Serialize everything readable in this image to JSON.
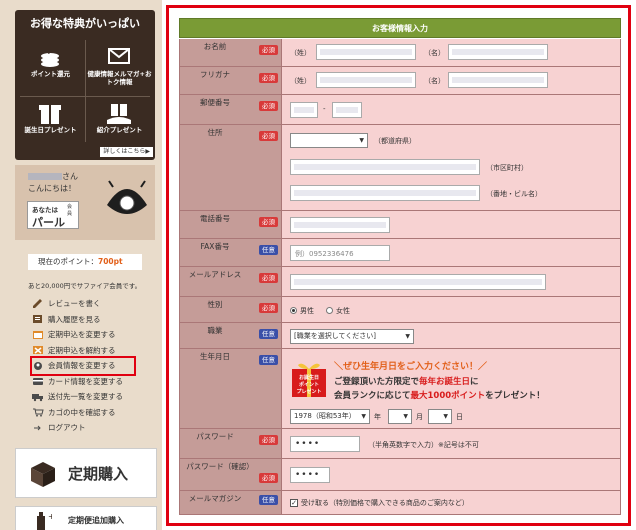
{
  "sidebar": {
    "perks_title": "お得な特典がいっぱい",
    "perks": [
      {
        "label": "ポイント還元",
        "icon": "coins-icon"
      },
      {
        "label": "健康情報メルマガ+おトク情報",
        "icon": "mail-icon"
      },
      {
        "label": "誕生日プレゼント",
        "icon": "gift-icon"
      },
      {
        "label": "紹介プレゼント",
        "icon": "gift-hand-icon"
      }
    ],
    "perks_more": "詳しくはこちら▶",
    "greeting_suffix": "さん",
    "greeting_hello": "こんにちは！",
    "rank_line1": "あなたは",
    "rank_line2": "パール",
    "rank_tag": "会員",
    "points_label": "現在のポイント：",
    "points_value": "700pt",
    "points_note": "あと20,000円でサファイア会員です。",
    "menu": [
      {
        "label": "レビューを書く",
        "icon": "pencil-icon"
      },
      {
        "label": "購入履歴を見る",
        "icon": "history-icon"
      },
      {
        "label": "定期申込を変更する",
        "icon": "calendar-icon"
      },
      {
        "label": "定期申込を解約する",
        "icon": "calendar-cancel-icon"
      },
      {
        "label": "会員情報を変更する",
        "icon": "member-icon"
      },
      {
        "label": "カード情報を変更する",
        "icon": "card-icon"
      },
      {
        "label": "送付先一覧を変更する",
        "icon": "truck-icon"
      },
      {
        "label": "カゴの中を確認する",
        "icon": "cart-icon"
      },
      {
        "label": "ログアウト",
        "icon": "logout-icon"
      }
    ],
    "teiki_button": "定期購入",
    "teiki_add_button": "定期便追加購入"
  },
  "form": {
    "title": "お客様情報入力",
    "badges": {
      "required": "必須",
      "optional": "任意"
    },
    "name": {
      "label": "お名前",
      "sei": "（姓）",
      "mei": "（名）"
    },
    "kana": {
      "label": "フリガナ",
      "sei": "（姓）",
      "mei": "（名）"
    },
    "zip": {
      "label": "郵便番号",
      "dash": "-"
    },
    "address": {
      "label": "住所",
      "pref_suffix": "（都道府県）",
      "city_suffix": "（市区町村）",
      "street_suffix": "（番地・ビル名）"
    },
    "tel": {
      "label": "電話番号"
    },
    "fax": {
      "label": "FAX番号",
      "placeholder": "例）0952336476"
    },
    "email": {
      "label": "メールアドレス"
    },
    "gender": {
      "label": "性別",
      "male": "男性",
      "female": "女性",
      "selected": "male"
    },
    "job": {
      "label": "職業",
      "selected": "[職業を選択してください]"
    },
    "birthday": {
      "label": "生年月日",
      "headline": "＼ぜひ生年月日をご入力ください！／",
      "line1_pre": "ご登録頂いた方限定で",
      "line1_red": "毎年お誕生日",
      "line1_post": "に",
      "line2_pre": "会員ランクに応じて",
      "line2_red": "最大1000ポイント",
      "line2_post": "をプレゼント！",
      "gift_text": "お誕生日ポイントプレゼント",
      "year": "1978（昭和53年）",
      "year_suffix": "年",
      "month_suffix": "月",
      "day_suffix": "日"
    },
    "password": {
      "label": "パスワード",
      "value": "••••",
      "note": "（半角英数字で入力）※記号は不可"
    },
    "password_confirm": {
      "label": "パスワード（確認）",
      "value": "••••"
    },
    "mailmag": {
      "label": "メールマガジン",
      "text": "受け取る（特別価格で購入できる商品のご案内など）"
    }
  }
}
